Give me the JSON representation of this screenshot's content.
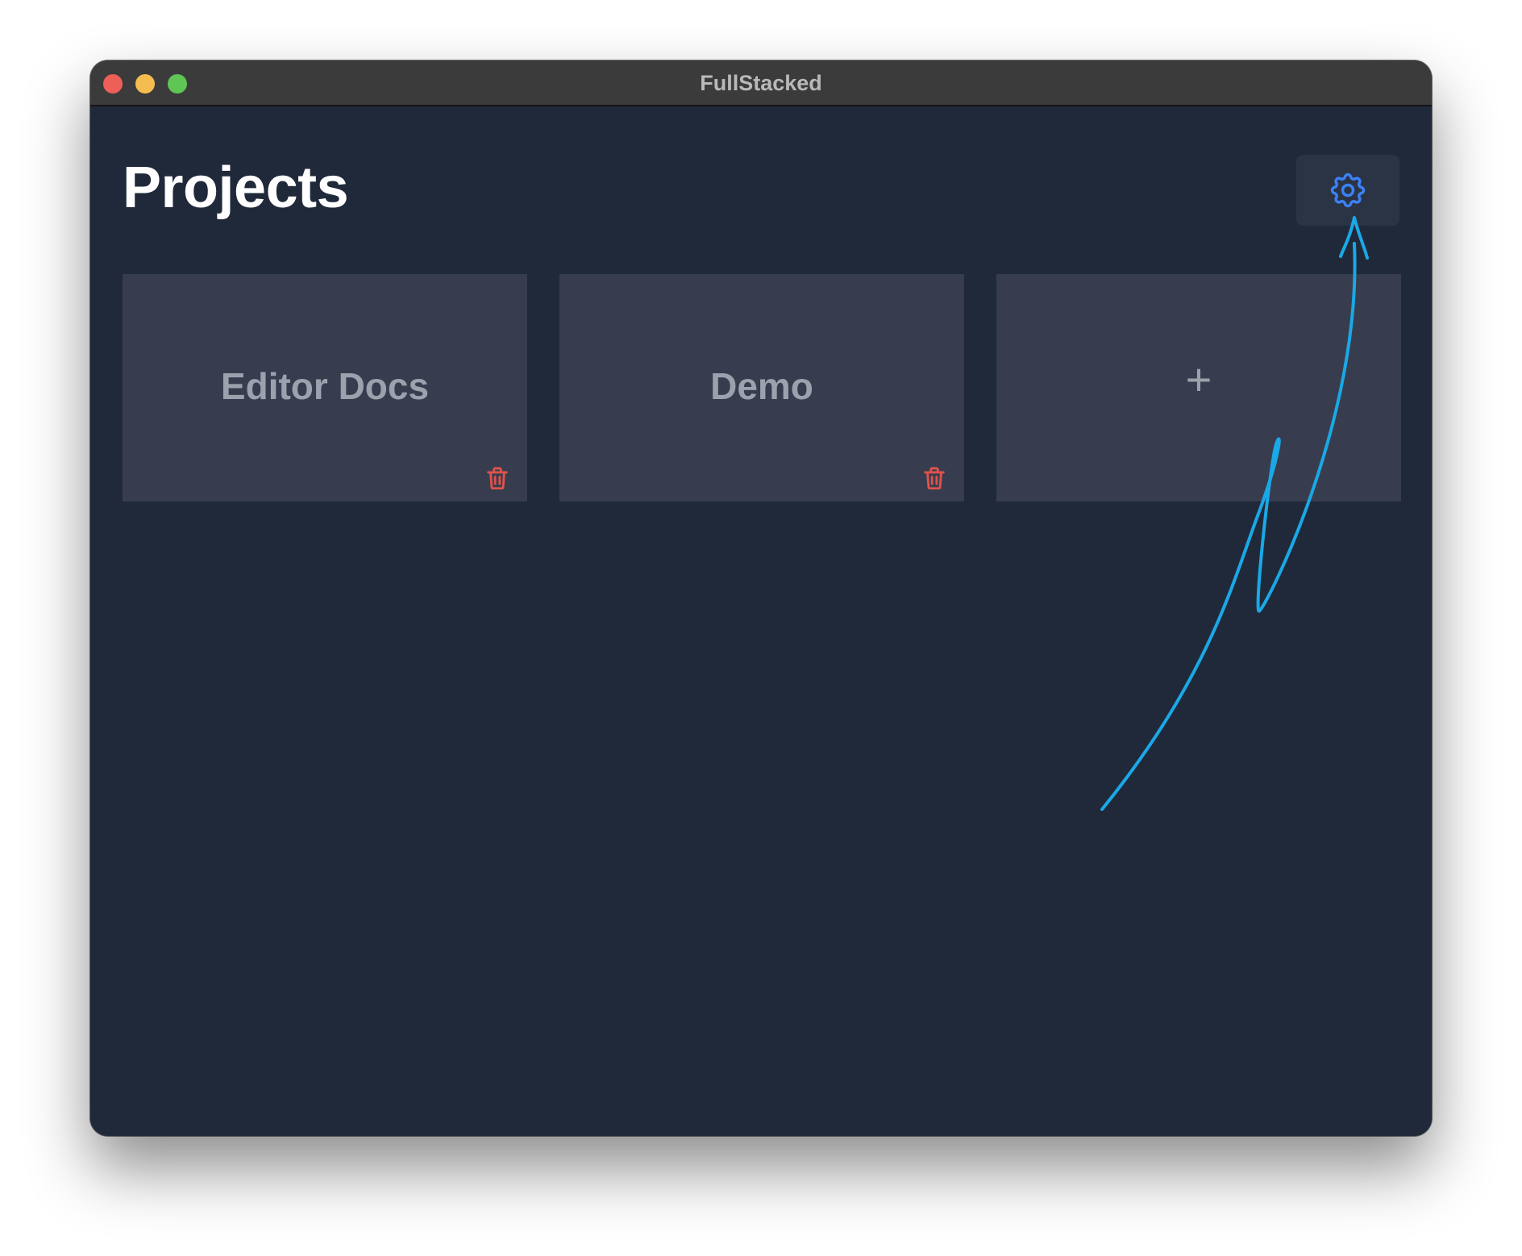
{
  "window": {
    "title": "FullStacked"
  },
  "header": {
    "title": "Projects",
    "settings_icon": "gear-icon"
  },
  "projects": [
    {
      "name": "Editor Docs",
      "delete_icon": "trash-icon"
    },
    {
      "name": "Demo",
      "delete_icon": "trash-icon"
    }
  ],
  "add_project": {
    "label": "+"
  },
  "colors": {
    "background": "#20293a",
    "card": "#373d4e",
    "accent": "#3b82f6",
    "danger": "#e0524b",
    "annotation": "#1aa8e6"
  }
}
